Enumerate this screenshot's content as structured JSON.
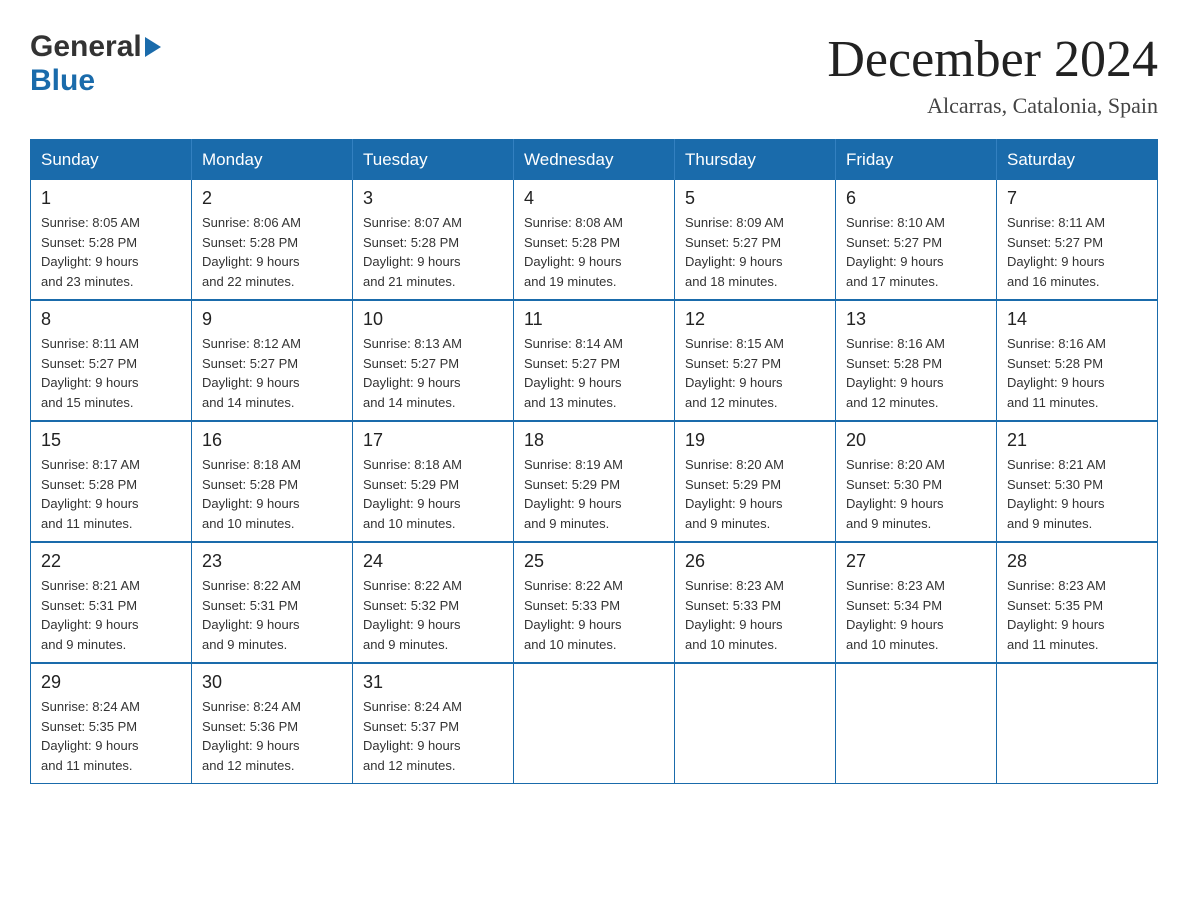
{
  "logo": {
    "general": "General",
    "blue": "Blue"
  },
  "title": {
    "month_year": "December 2024",
    "location": "Alcarras, Catalonia, Spain"
  },
  "days_header": [
    "Sunday",
    "Monday",
    "Tuesday",
    "Wednesday",
    "Thursday",
    "Friday",
    "Saturday"
  ],
  "weeks": [
    [
      {
        "day": "1",
        "info": "Sunrise: 8:05 AM\nSunset: 5:28 PM\nDaylight: 9 hours\nand 23 minutes."
      },
      {
        "day": "2",
        "info": "Sunrise: 8:06 AM\nSunset: 5:28 PM\nDaylight: 9 hours\nand 22 minutes."
      },
      {
        "day": "3",
        "info": "Sunrise: 8:07 AM\nSunset: 5:28 PM\nDaylight: 9 hours\nand 21 minutes."
      },
      {
        "day": "4",
        "info": "Sunrise: 8:08 AM\nSunset: 5:28 PM\nDaylight: 9 hours\nand 19 minutes."
      },
      {
        "day": "5",
        "info": "Sunrise: 8:09 AM\nSunset: 5:27 PM\nDaylight: 9 hours\nand 18 minutes."
      },
      {
        "day": "6",
        "info": "Sunrise: 8:10 AM\nSunset: 5:27 PM\nDaylight: 9 hours\nand 17 minutes."
      },
      {
        "day": "7",
        "info": "Sunrise: 8:11 AM\nSunset: 5:27 PM\nDaylight: 9 hours\nand 16 minutes."
      }
    ],
    [
      {
        "day": "8",
        "info": "Sunrise: 8:11 AM\nSunset: 5:27 PM\nDaylight: 9 hours\nand 15 minutes."
      },
      {
        "day": "9",
        "info": "Sunrise: 8:12 AM\nSunset: 5:27 PM\nDaylight: 9 hours\nand 14 minutes."
      },
      {
        "day": "10",
        "info": "Sunrise: 8:13 AM\nSunset: 5:27 PM\nDaylight: 9 hours\nand 14 minutes."
      },
      {
        "day": "11",
        "info": "Sunrise: 8:14 AM\nSunset: 5:27 PM\nDaylight: 9 hours\nand 13 minutes."
      },
      {
        "day": "12",
        "info": "Sunrise: 8:15 AM\nSunset: 5:27 PM\nDaylight: 9 hours\nand 12 minutes."
      },
      {
        "day": "13",
        "info": "Sunrise: 8:16 AM\nSunset: 5:28 PM\nDaylight: 9 hours\nand 12 minutes."
      },
      {
        "day": "14",
        "info": "Sunrise: 8:16 AM\nSunset: 5:28 PM\nDaylight: 9 hours\nand 11 minutes."
      }
    ],
    [
      {
        "day": "15",
        "info": "Sunrise: 8:17 AM\nSunset: 5:28 PM\nDaylight: 9 hours\nand 11 minutes."
      },
      {
        "day": "16",
        "info": "Sunrise: 8:18 AM\nSunset: 5:28 PM\nDaylight: 9 hours\nand 10 minutes."
      },
      {
        "day": "17",
        "info": "Sunrise: 8:18 AM\nSunset: 5:29 PM\nDaylight: 9 hours\nand 10 minutes."
      },
      {
        "day": "18",
        "info": "Sunrise: 8:19 AM\nSunset: 5:29 PM\nDaylight: 9 hours\nand 9 minutes."
      },
      {
        "day": "19",
        "info": "Sunrise: 8:20 AM\nSunset: 5:29 PM\nDaylight: 9 hours\nand 9 minutes."
      },
      {
        "day": "20",
        "info": "Sunrise: 8:20 AM\nSunset: 5:30 PM\nDaylight: 9 hours\nand 9 minutes."
      },
      {
        "day": "21",
        "info": "Sunrise: 8:21 AM\nSunset: 5:30 PM\nDaylight: 9 hours\nand 9 minutes."
      }
    ],
    [
      {
        "day": "22",
        "info": "Sunrise: 8:21 AM\nSunset: 5:31 PM\nDaylight: 9 hours\nand 9 minutes."
      },
      {
        "day": "23",
        "info": "Sunrise: 8:22 AM\nSunset: 5:31 PM\nDaylight: 9 hours\nand 9 minutes."
      },
      {
        "day": "24",
        "info": "Sunrise: 8:22 AM\nSunset: 5:32 PM\nDaylight: 9 hours\nand 9 minutes."
      },
      {
        "day": "25",
        "info": "Sunrise: 8:22 AM\nSunset: 5:33 PM\nDaylight: 9 hours\nand 10 minutes."
      },
      {
        "day": "26",
        "info": "Sunrise: 8:23 AM\nSunset: 5:33 PM\nDaylight: 9 hours\nand 10 minutes."
      },
      {
        "day": "27",
        "info": "Sunrise: 8:23 AM\nSunset: 5:34 PM\nDaylight: 9 hours\nand 10 minutes."
      },
      {
        "day": "28",
        "info": "Sunrise: 8:23 AM\nSunset: 5:35 PM\nDaylight: 9 hours\nand 11 minutes."
      }
    ],
    [
      {
        "day": "29",
        "info": "Sunrise: 8:24 AM\nSunset: 5:35 PM\nDaylight: 9 hours\nand 11 minutes."
      },
      {
        "day": "30",
        "info": "Sunrise: 8:24 AM\nSunset: 5:36 PM\nDaylight: 9 hours\nand 12 minutes."
      },
      {
        "day": "31",
        "info": "Sunrise: 8:24 AM\nSunset: 5:37 PM\nDaylight: 9 hours\nand 12 minutes."
      },
      {
        "day": "",
        "info": ""
      },
      {
        "day": "",
        "info": ""
      },
      {
        "day": "",
        "info": ""
      },
      {
        "day": "",
        "info": ""
      }
    ]
  ]
}
